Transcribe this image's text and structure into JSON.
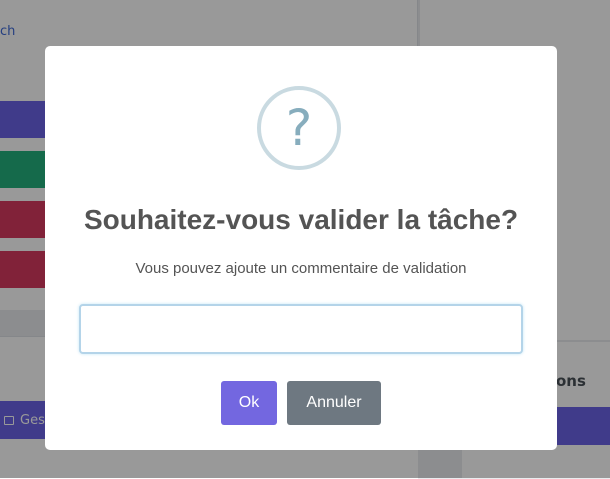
{
  "background": {
    "link_text": "ch",
    "bottom_button_label": "Ges",
    "right_heading": "ons"
  },
  "dialog": {
    "icon": "question-icon",
    "icon_glyph": "?",
    "title": "Souhaitez-vous valider la tâche?",
    "text": "Vous pouvez ajoute un commentaire de validation",
    "input_value": "",
    "input_placeholder": "",
    "confirm_label": "Ok",
    "cancel_label": "Annuler"
  },
  "colors": {
    "confirm": "#7367e0",
    "cancel": "#6e7881",
    "icon_border": "#c9dae1",
    "icon_glyph": "#87adbd"
  }
}
